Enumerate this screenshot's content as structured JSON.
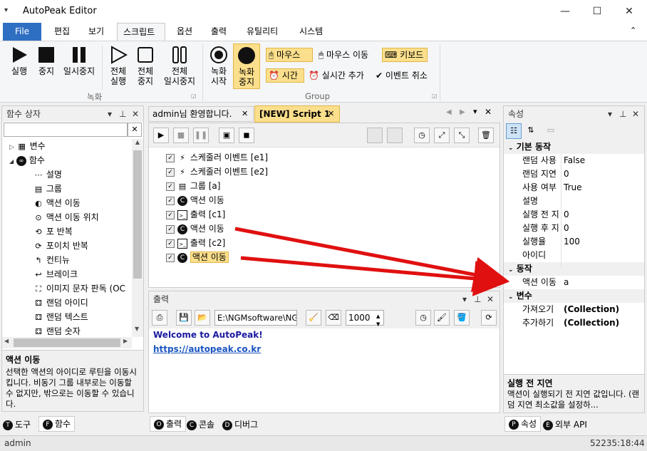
{
  "window": {
    "title": "AutoPeak Editor",
    "minimize": "—",
    "maximize": "☐",
    "close": "✕",
    "menu_glyph": "▾",
    "collapse_glyph": "⌃"
  },
  "ribbon_tabs": [
    "File",
    "편집",
    "보기",
    "스크립트",
    "옵션",
    "출력",
    "유틸리티",
    "시스템"
  ],
  "ribbon": {
    "record_group": {
      "label": "녹화",
      "buttons": [
        {
          "label": "실행",
          "icon": "play-icon"
        },
        {
          "label": "중지",
          "icon": "stop-icon"
        },
        {
          "label": "일시중지",
          "icon": "pause-icon"
        },
        {
          "label": "전체\n실행",
          "icon": "play-all-icon"
        },
        {
          "label": "전체\n중지",
          "icon": "stop-all-icon"
        },
        {
          "label": "전체\n일시중지",
          "icon": "pause-all-icon"
        }
      ]
    },
    "group2": {
      "label": "Group",
      "record_start": "녹화\n시작",
      "record_stop": "녹화\n중지",
      "mouse": "마우스",
      "mouse_move": "마우스 이동",
      "keyboard": "키보드",
      "time": "시간",
      "realtime_add": "실시간 추가",
      "event_cancel": "이벤트 취소"
    }
  },
  "functions_panel": {
    "title": "함수 상자",
    "search_value": "",
    "clear": "✕",
    "tree": [
      {
        "label": "변수",
        "level": 0,
        "expander": "▷",
        "icon": "variables-icon"
      },
      {
        "label": "함수",
        "level": 0,
        "expander": "◢",
        "icon": "function-icon"
      },
      {
        "label": "설명",
        "level": 1,
        "icon": "comment-icon"
      },
      {
        "label": "그룹",
        "level": 1,
        "icon": "group-icon"
      },
      {
        "label": "액션 이동",
        "level": 1,
        "icon": "action-move-icon"
      },
      {
        "label": "액션 이동 위치",
        "level": 1,
        "icon": "action-position-icon"
      },
      {
        "label": "포 반복",
        "level": 1,
        "icon": "loop-icon"
      },
      {
        "label": "포이치 반복",
        "level": 1,
        "icon": "foreach-icon"
      },
      {
        "label": "컨티뉴",
        "level": 1,
        "icon": "continue-icon"
      },
      {
        "label": "브레이크",
        "level": 1,
        "icon": "break-icon"
      },
      {
        "label": "이미지 문자 판독 (OC",
        "level": 1,
        "icon": "ocr-icon"
      },
      {
        "label": "랜덤 아이디",
        "level": 1,
        "icon": "random-icon"
      },
      {
        "label": "랜덤 텍스트",
        "level": 1,
        "icon": "random-text-icon"
      },
      {
        "label": "랜덤 숫자",
        "level": 1,
        "icon": "random-number-icon"
      }
    ],
    "desc_title": "액션 이동",
    "desc_text": "선택한 액션의 아이디로 루틴을 이동시킵니다. 비동기 그룹 내부로는 이동할 수 없지만, 밖으로는 이동할 수 있습니다.",
    "tabs": [
      {
        "badge": "T",
        "label": "도구"
      },
      {
        "badge": "F",
        "label": "함수"
      }
    ]
  },
  "doc_tabs": [
    {
      "label": "admin님 환영합니다.",
      "close": "✕"
    },
    {
      "label": "[NEW] Script 1",
      "close": "✕"
    }
  ],
  "script": {
    "items": [
      {
        "label": "스케줄러 이벤트 [e1]",
        "icon": "⚡"
      },
      {
        "label": "스케줄러 이벤트 [e2]",
        "icon": "⚡"
      },
      {
        "label": "그룹 [a]",
        "icon": "▤"
      },
      {
        "label": "액션 이동",
        "icon": "C"
      },
      {
        "label": "출력 [c1]",
        "icon": ">_"
      },
      {
        "label": "액션 이동",
        "icon": "C"
      },
      {
        "label": "출력 [c2]",
        "icon": ">_"
      },
      {
        "label": "액션 이동",
        "icon": "C",
        "selected": true
      }
    ]
  },
  "output_panel": {
    "title": "출력",
    "path_value": "E:\\NGMsoftware\\NG",
    "delay_value": "1000",
    "lines": [
      "Welcome to AutoPeak!",
      "https://autopeak.co.kr"
    ],
    "tabs": [
      {
        "badge": "O",
        "label": "출력"
      },
      {
        "badge": "C",
        "label": "콘솔"
      },
      {
        "badge": "D",
        "label": "디버그"
      }
    ]
  },
  "props_panel": {
    "title": "속성",
    "sections": [
      {
        "name": "기본 동작",
        "rows": [
          {
            "key": "랜덤 사용",
            "value": "False"
          },
          {
            "key": "랜덤 지연",
            "value": "0"
          },
          {
            "key": "사용 여부",
            "value": "True"
          },
          {
            "key": "설명",
            "value": ""
          },
          {
            "key": "실행 전 지",
            "value": "0"
          },
          {
            "key": "실행 후 지",
            "value": "0"
          },
          {
            "key": "실행율",
            "value": "100"
          },
          {
            "key": "아이디",
            "value": ""
          }
        ]
      },
      {
        "name": "동작",
        "rows": [
          {
            "key": "액션 이동",
            "value": "a"
          }
        ]
      },
      {
        "name": "변수",
        "rows": [
          {
            "key": "가져오기",
            "value": "(Collection)"
          },
          {
            "key": "추가하기",
            "value": "(Collection)"
          }
        ]
      }
    ],
    "desc_title": "실행 전 지연",
    "desc_text": "액션이 실행되기 전 지연 값입니다. (랜덤 지연 최소값을 설정하...",
    "tabs": [
      {
        "badge": "P",
        "label": "속성"
      },
      {
        "badge": "E",
        "label": "외부 API"
      }
    ]
  },
  "statusbar": {
    "user": "admin",
    "clock": "52235:18:44"
  },
  "colors": {
    "accent": "#2f6fc2",
    "highlight": "#fbdf8c",
    "arrow": "#e01010",
    "link": "#1a55c0",
    "welcome": "#1a1aa0"
  }
}
